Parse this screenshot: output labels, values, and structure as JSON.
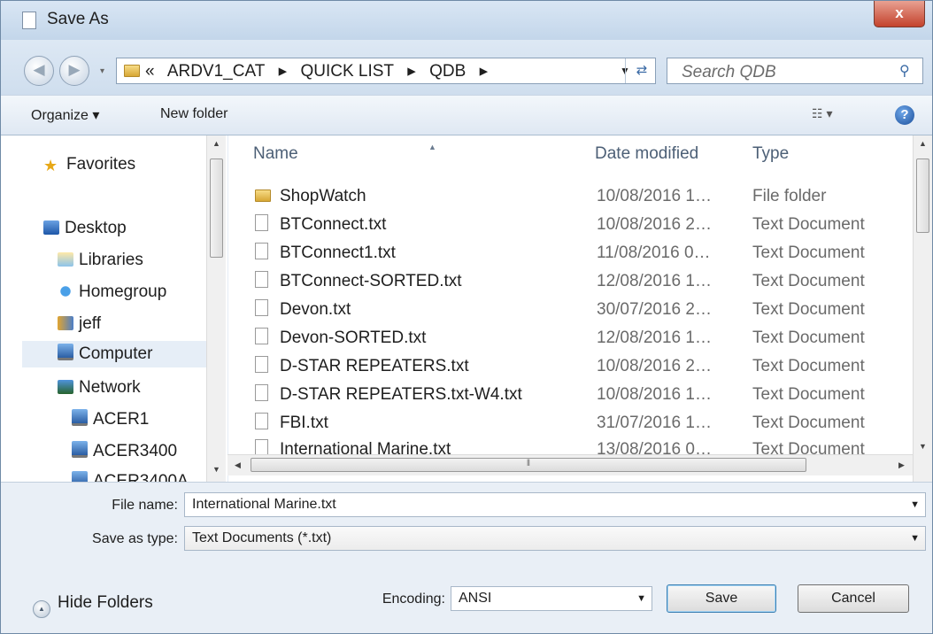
{
  "window": {
    "title": "Save As",
    "close_glyph": "x"
  },
  "address": {
    "overflow": "«",
    "segments": [
      "ARDV1_CAT",
      "QUICK LIST",
      "QDB"
    ],
    "separator": "▸",
    "search_placeholder": "Search QDB"
  },
  "toolbar": {
    "organize": "Organize ▾",
    "new_folder": "New folder",
    "views": "☷ ▾",
    "help": "?"
  },
  "nav": {
    "favorites": "Favorites",
    "desktop": "Desktop",
    "libraries": "Libraries",
    "homegroup": "Homegroup",
    "jeff": "jeff",
    "computer": "Computer",
    "network": "Network",
    "acer1": "ACER1",
    "acer3400": "ACER3400",
    "acer3400a": "ACER3400A"
  },
  "columns": {
    "name": "Name",
    "date": "Date modified",
    "type": "Type"
  },
  "files": [
    {
      "name": "ShopWatch",
      "date": "10/08/2016 1…",
      "type": "File folder",
      "icon": "folder-icon"
    },
    {
      "name": "BTConnect.txt",
      "date": "10/08/2016 2…",
      "type": "Text Document",
      "icon": "text-file-icon"
    },
    {
      "name": "BTConnect1.txt",
      "date": "11/08/2016 0…",
      "type": "Text Document",
      "icon": "text-file-icon"
    },
    {
      "name": "BTConnect-SORTED.txt",
      "date": "12/08/2016 1…",
      "type": "Text Document",
      "icon": "text-file-icon"
    },
    {
      "name": "Devon.txt",
      "date": "30/07/2016 2…",
      "type": "Text Document",
      "icon": "text-file-icon"
    },
    {
      "name": "Devon-SORTED.txt",
      "date": "12/08/2016 1…",
      "type": "Text Document",
      "icon": "text-file-icon"
    },
    {
      "name": "D-STAR REPEATERS.txt",
      "date": "10/08/2016 2…",
      "type": "Text Document",
      "icon": "text-file-icon"
    },
    {
      "name": "D-STAR REPEATERS.txt-W4.txt",
      "date": "10/08/2016 1…",
      "type": "Text Document",
      "icon": "text-file-icon"
    },
    {
      "name": "FBI.txt",
      "date": "31/07/2016 1…",
      "type": "Text Document",
      "icon": "text-file-icon"
    },
    {
      "name": "International Marine.txt",
      "date": "13/08/2016 0…",
      "type": "Text Document",
      "icon": "text-file-icon"
    }
  ],
  "form": {
    "file_name_label": "File name:",
    "file_name_value": "International Marine.txt",
    "save_type_label": "Save as type:",
    "save_type_value": "Text Documents (*.txt)",
    "encoding_label": "Encoding:",
    "encoding_value": "ANSI"
  },
  "buttons": {
    "save": "Save",
    "cancel": "Cancel",
    "hide_folders": "Hide Folders"
  }
}
